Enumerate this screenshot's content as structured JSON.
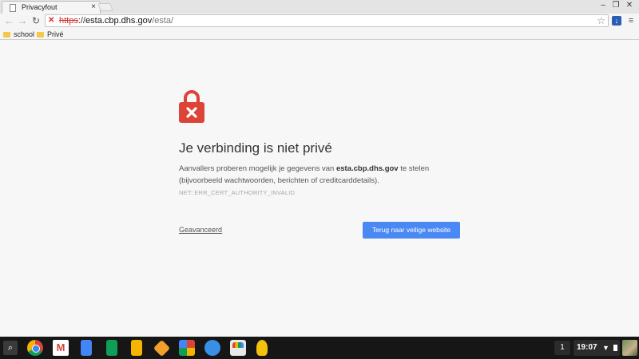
{
  "browser": {
    "tab": {
      "title": "Privacyfout",
      "close_symbol": "×",
      "favicon": "page-icon"
    },
    "window_controls": {
      "minimize": "–",
      "restore": "❐",
      "close": "✕"
    },
    "nav": {
      "back": "←",
      "forward": "→",
      "reload": "↻"
    },
    "omnibox": {
      "security_icon": "broken-lock-icon",
      "scheme": "https",
      "separator": "://",
      "host": "esta.cbp.dhs.gov",
      "path": "/esta/"
    },
    "star_symbol": "☆",
    "extension_icon": "download-icon",
    "menu_symbol": "≡",
    "bookmarks": [
      {
        "label": "school",
        "icon": "folder-icon"
      },
      {
        "label": "Privé",
        "icon": "folder-icon"
      }
    ]
  },
  "interstitial": {
    "icon": "red-padlock-icon",
    "heading": "Je verbinding is niet privé",
    "description_prefix": "Aanvallers proberen mogelijk je gegevens van ",
    "description_host": "esta.cbp.dhs.gov",
    "description_suffix": " te stelen (bijvoorbeeld wachtwoorden, berichten of creditcarddetails).",
    "error_code": "NET::ERR_CERT_AUTHORITY_INVALID",
    "advanced_link": "Geavanceerd",
    "back_button": "Terug naar veilige website",
    "accent_color": "#4a89f3",
    "lock_color": "#db4437"
  },
  "shelf": {
    "launcher_symbol": "⌕",
    "apps": [
      "chrome-icon",
      "gmail-icon",
      "docs-icon",
      "sheets-icon",
      "slides-icon",
      "keep-icon",
      "photos-icon",
      "files-icon",
      "web-store-icon",
      "keep-bulb-icon"
    ],
    "notification_count": "1",
    "time": "19:07"
  }
}
